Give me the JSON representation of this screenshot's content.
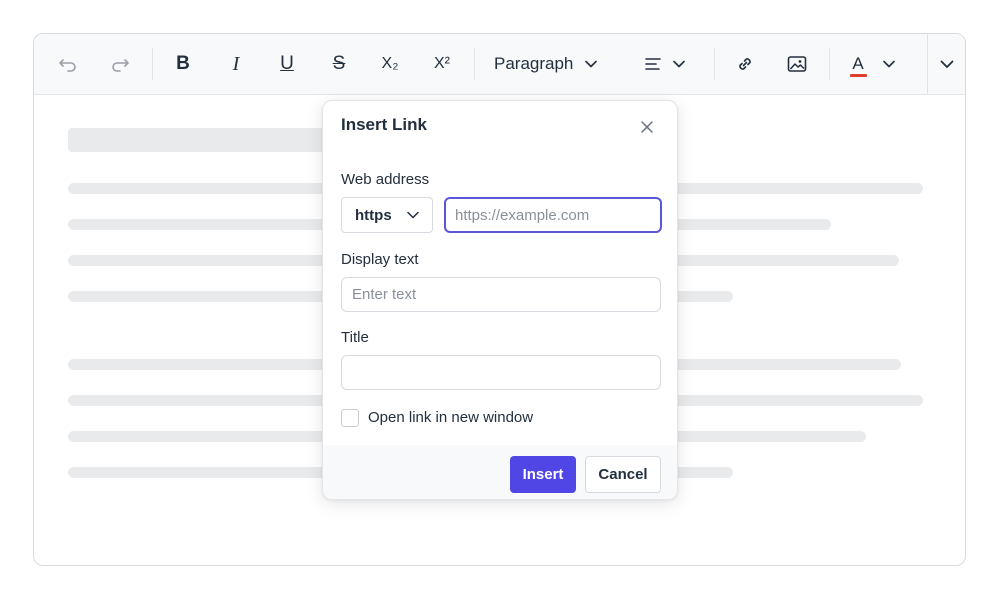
{
  "toolbar": {
    "undo_icon": "undo-icon",
    "redo_icon": "redo-icon",
    "bold_label": "B",
    "italic_label": "I",
    "underline_label": "U",
    "strike_label": "S",
    "subscript_label": "X₂",
    "superscript_label": "X²",
    "block_format_label": "Paragraph",
    "font_color_label": "A",
    "font_color_underline": "#e03e2d",
    "disabled_color": "#9aa0a8"
  },
  "dialog": {
    "title": "Insert Link",
    "web_address_label": "Web address",
    "protocol_selected": "https",
    "url_value": "",
    "url_placeholder": "https://example.com",
    "display_text_label": "Display text",
    "display_text_value": "",
    "display_text_placeholder": "Enter text",
    "title_label": "Title",
    "title_value": "",
    "new_window_label": "Open link in new window",
    "new_window_checked": false,
    "insert_label": "Insert",
    "cancel_label": "Cancel",
    "primary_color": "#4f46e5",
    "focus_color": "#5b56d6"
  }
}
